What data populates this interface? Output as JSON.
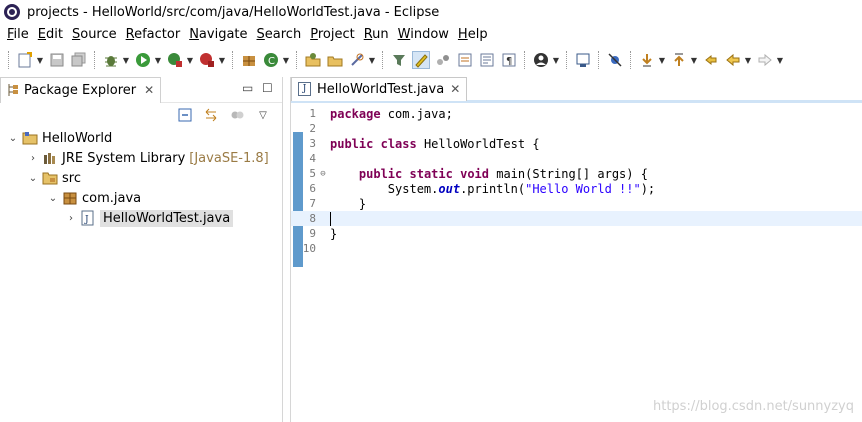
{
  "window": {
    "title": "projects - HelloWorld/src/com/java/HelloWorldTest.java - Eclipse"
  },
  "menu": [
    "File",
    "Edit",
    "Source",
    "Refactor",
    "Navigate",
    "Search",
    "Project",
    "Run",
    "Window",
    "Help"
  ],
  "left_panel": {
    "tab_label": "Package Explorer",
    "tree": [
      {
        "label": "HelloWorld",
        "depth": 0,
        "expanded": true,
        "icon": "project-folder-icon"
      },
      {
        "label": "JRE System Library",
        "decoration": "[JavaSE-1.8]",
        "depth": 1,
        "expanded": false,
        "icon": "library-icon"
      },
      {
        "label": "src",
        "depth": 1,
        "expanded": true,
        "icon": "source-folder-icon"
      },
      {
        "label": "com.java",
        "depth": 2,
        "expanded": true,
        "icon": "package-icon"
      },
      {
        "label": "HelloWorldTest.java",
        "depth": 3,
        "expanded": false,
        "icon": "java-file-icon",
        "selected": true
      }
    ]
  },
  "editor": {
    "tab_label": "HelloWorldTest.java",
    "lines": [
      {
        "n": "1",
        "text": "package com.java;"
      },
      {
        "n": "2",
        "text": ""
      },
      {
        "n": "3",
        "text": "public class HelloWorldTest {"
      },
      {
        "n": "4",
        "text": ""
      },
      {
        "n": "5",
        "text": "    public static void main(String[] args) {"
      },
      {
        "n": "6",
        "text": "        System.out.println(\"Hello World !!\");"
      },
      {
        "n": "7",
        "text": "    }"
      },
      {
        "n": "8",
        "text": ""
      },
      {
        "n": "9",
        "text": "}"
      },
      {
        "n": "10",
        "text": ""
      }
    ],
    "current_line": "8"
  },
  "watermark": "https://blog.csdn.net/sunnyzyq"
}
